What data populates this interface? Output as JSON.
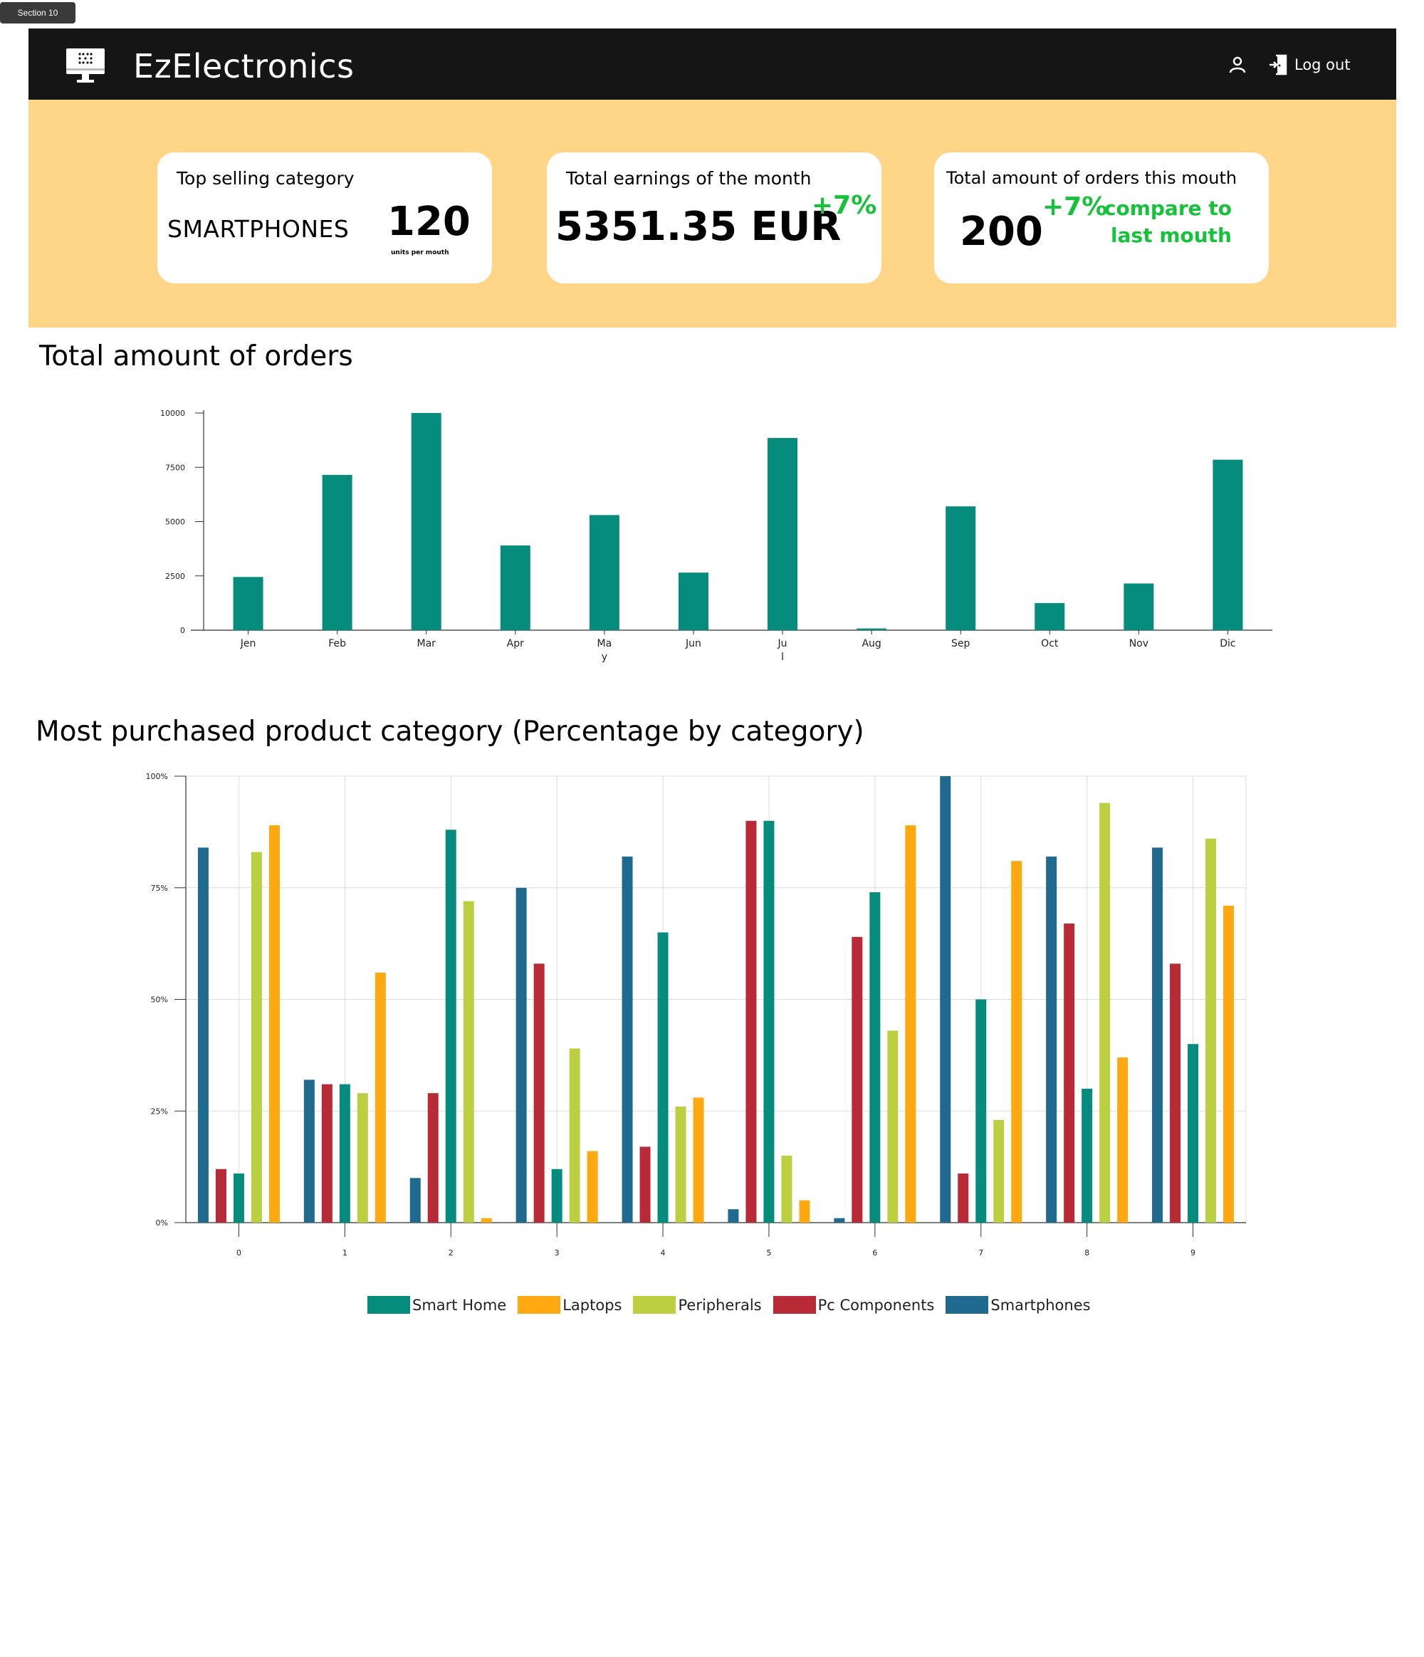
{
  "section_tag": "Section 10",
  "navbar": {
    "brand": "EzElectronics",
    "logo_icon": "computer-monitor-icon",
    "user_icon": "user-icon",
    "logout_icon": "logout-door-icon",
    "logout_label": "Log out",
    "background": "#151515"
  },
  "hero": {
    "background": "#ffd587",
    "cards": {
      "top_category": {
        "title": "Top selling category",
        "category": "SMARTPHONES",
        "value": "120",
        "unit": "units per mouth"
      },
      "earnings": {
        "title": "Total earnings of the month",
        "value": "5351.35 EUR",
        "change": "+7%"
      },
      "orders": {
        "title": "Total amount of orders this mouth",
        "value": "200",
        "change": "+7%",
        "compare_line1": "compare to",
        "compare_line2": "last mouth"
      }
    },
    "accent_green": "#17c23b"
  },
  "orders_section": {
    "title": "Total amount of orders"
  },
  "category_section": {
    "title": "Most purchased product category (Percentage by category)"
  },
  "chart_data": [
    {
      "type": "bar",
      "categories": [
        "Jen",
        "Feb",
        "Mar",
        "Apr",
        "Ma\ny",
        "Jun",
        "Ju\nl",
        "Aug",
        "Sep",
        "Oct",
        "Nov",
        "Dic"
      ],
      "values": [
        2450,
        7150,
        10000,
        3900,
        5300,
        2650,
        8850,
        80,
        5700,
        1250,
        2150,
        7850
      ],
      "ylim": [
        0,
        10000
      ],
      "yticks": [
        0,
        2500,
        5000,
        7500,
        10000
      ],
      "color": "#068c7c",
      "grid": false
    },
    {
      "type": "bar",
      "categories": [
        "0",
        "1",
        "2",
        "3",
        "4",
        "5",
        "6",
        "7",
        "8",
        "9"
      ],
      "series": [
        {
          "name": "Smartphones",
          "color": "#216a8f",
          "values": [
            84,
            32,
            10,
            75,
            82,
            3,
            1,
            100,
            82,
            84
          ]
        },
        {
          "name": "Pc Components",
          "color": "#b92a37",
          "values": [
            12,
            31,
            29,
            58,
            17,
            90,
            64,
            11,
            67,
            58
          ]
        },
        {
          "name": "Smart Home",
          "color": "#068c7c",
          "values": [
            11,
            31,
            88,
            12,
            65,
            90,
            74,
            50,
            30,
            40
          ]
        },
        {
          "name": "Peripherals",
          "color": "#bccf41",
          "values": [
            83,
            29,
            72,
            39,
            26,
            15,
            43,
            23,
            94,
            86
          ]
        },
        {
          "name": "Laptops",
          "color": "#fea812",
          "values": [
            89,
            56,
            1,
            16,
            28,
            5,
            89,
            81,
            37,
            71
          ]
        }
      ],
      "ylim": [
        0,
        100
      ],
      "yticks": [
        "0%",
        "25%",
        "50%",
        "75%",
        "100%"
      ],
      "legend_order": [
        "Smart Home",
        "Laptops",
        "Peripherals",
        "Pc Components",
        "Smartphones"
      ],
      "legend_position": "bottom",
      "grid": true
    }
  ]
}
